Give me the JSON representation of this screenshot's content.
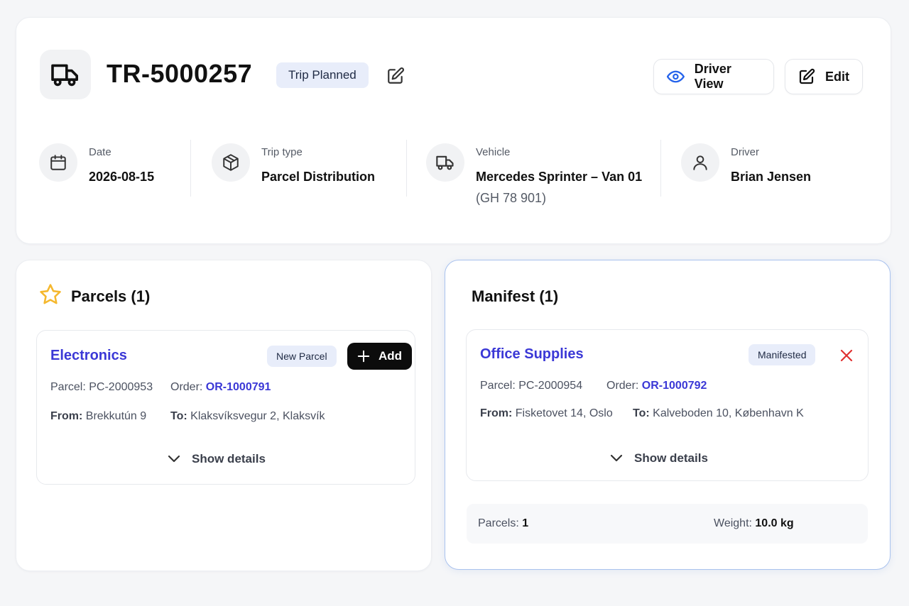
{
  "trip": {
    "id": "TR-5000257",
    "status": "Trip Planned"
  },
  "actions": {
    "driver_view": "Driver View",
    "edit": "Edit"
  },
  "info": {
    "date": {
      "label": "Date",
      "value": "2026-08-15",
      "icon": "calendar-icon"
    },
    "trip_type": {
      "label": "Trip type",
      "value": "Parcel Distribution",
      "icon": "box-icon"
    },
    "vehicle": {
      "label": "Vehicle",
      "value": "Mercedes Sprinter – Van 01",
      "plate": "(GH 78 901)",
      "icon": "truck-icon"
    },
    "driver": {
      "label": "Driver",
      "value": "Brian Jensen",
      "icon": "user-icon"
    }
  },
  "parcels": {
    "title": "Parcels (1)",
    "items": [
      {
        "name": "Electronics",
        "badge": "New Parcel",
        "add_label": "Add",
        "parcel_label": "Parcel:",
        "parcel_id": "PC-2000953",
        "order_label": "Order:",
        "order_id": "OR-1000791",
        "from_label": "From:",
        "from": "Brekkutún 9",
        "to_label": "To:",
        "to": "Klaksvíksvegur 2, Klaksvík",
        "details_label": "Show details"
      }
    ]
  },
  "manifest": {
    "title": "Manifest (1)",
    "items": [
      {
        "name": "Office Supplies",
        "badge": "Manifested",
        "parcel_label": "Parcel:",
        "parcel_id": "PC-2000954",
        "order_label": "Order:",
        "order_id": "OR-1000792",
        "from_label": "From:",
        "from": "Fisketovet 14, Oslo",
        "to_label": "To:",
        "to": "Kalveboden 10, København K",
        "details_label": "Show details"
      }
    ],
    "summary": {
      "parcels_label": "Parcels:",
      "parcels_value": "1",
      "weight_label": "Weight:",
      "weight_value": "10.0 kg"
    }
  },
  "colors": {
    "accent": "#3b38d6",
    "badge_bg": "#e8edfa",
    "remove": "#e03131",
    "star": "#f5b82e",
    "eye": "#2563eb"
  }
}
